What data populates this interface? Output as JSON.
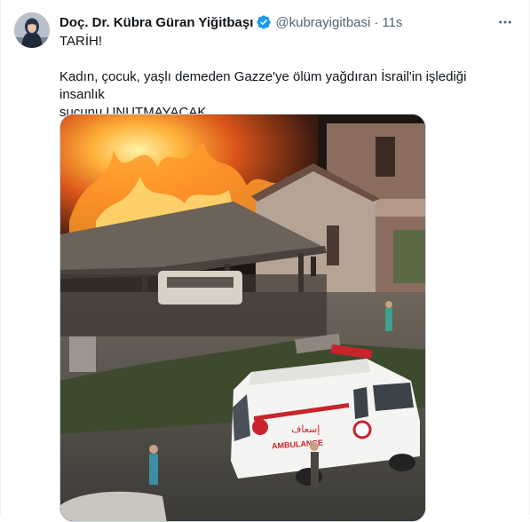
{
  "tweet": {
    "author_name": "Doç. Dr. Kübra Güran Yiğitbaşı",
    "handle": "@kubrayigitbasi",
    "separator": "·",
    "timestamp": "11s",
    "verified": true,
    "text_line1": "TARİH!",
    "text_line2": "Kadın, çocuk, yaşlı demeden Gazze'ye ölüm yağdıran İsrail'in işlediği insanlık",
    "text_line3": "suçunu UNUTMAYACAK.."
  },
  "photo": {
    "ambulance_arabic": "إسعاف",
    "ambulance_label": "AMBULANCE"
  },
  "colors": {
    "verified": "#1d9bf0",
    "secondary_text": "#536471",
    "border": "#cfd9de"
  },
  "icons": {
    "verified": "verified-badge-icon",
    "more": "more-horizontal-icon"
  }
}
